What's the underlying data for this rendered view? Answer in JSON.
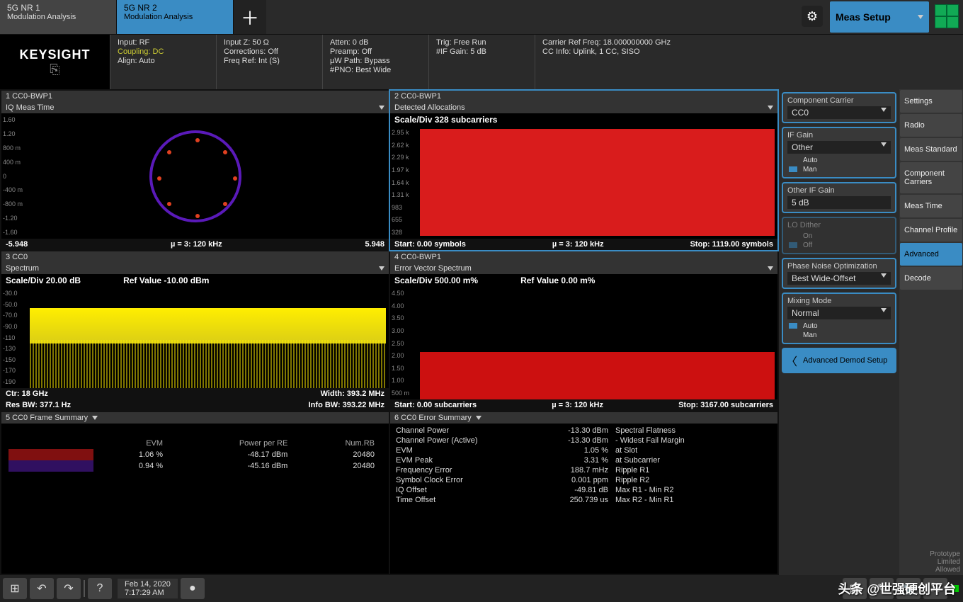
{
  "tabs": [
    {
      "title": "5G NR 1",
      "sub": "Modulation Analysis"
    },
    {
      "title": "5G NR 2",
      "sub": "Modulation Analysis"
    }
  ],
  "logo": "KEYSIGHT",
  "info": {
    "c1": {
      "a": "Input: RF",
      "b": "Coupling: DC",
      "c": "Align: Auto"
    },
    "c2": {
      "a": "Input Z: 50 Ω",
      "b": "Corrections: Off",
      "c": "Freq Ref: Int (S)"
    },
    "c3": {
      "a": "Atten: 0 dB",
      "b": "Preamp: Off",
      "c": "µW Path: Bypass",
      "d": "#PNO: Best Wide"
    },
    "c4": {
      "a": "Trig: Free Run",
      "b": "#IF Gain: 5 dB"
    },
    "c5": {
      "a": "Carrier Ref Freq: 18.000000000 GHz",
      "b": "CC Info: Uplink, 1 CC, SISO"
    }
  },
  "panels": {
    "p1": {
      "hdr1": "1 CC0-BWP1",
      "hdr2": "IQ Meas Time",
      "yticks": [
        "1.60",
        "1.20",
        "800 m",
        "400 m",
        "0",
        "-400 m",
        "-800 m",
        "-1.20",
        "-1.60"
      ],
      "fL": "-5.948",
      "fC": "µ = 3: 120 kHz",
      "fR": "5.948"
    },
    "p2": {
      "hdr1": "2 CC0-BWP1",
      "hdr2": "Detected Allocations",
      "scale": "Scale/Div 328 subcarriers",
      "yticks": [
        "2.95 k",
        "2.62 k",
        "2.29 k",
        "1.97 k",
        "1.64 k",
        "1.31 k",
        "983",
        "655",
        "328"
      ],
      "fL": "Start: 0.00 symbols",
      "fC": "µ = 3: 120 kHz",
      "fR": "Stop: 1119.00 symbols"
    },
    "p3": {
      "hdr1": "3 CC0",
      "hdr2": "Spectrum",
      "scaleL": "Scale/Div 20.00 dB",
      "scaleR": "Ref Value -10.00 dBm",
      "yticks": [
        "-30.0",
        "-50.0",
        "-70.0",
        "-90.0",
        "-110",
        "-130",
        "-150",
        "-170",
        "-190"
      ],
      "fL": "Ctr: 18 GHz",
      "fR": "Width: 393.2 MHz",
      "f2L": "Res BW: 377.1 Hz",
      "f2R": "Info BW: 393.22 MHz"
    },
    "p4": {
      "hdr1": "4 CC0-BWP1",
      "hdr2": "Error Vector Spectrum",
      "scaleL": "Scale/Div 500.00 m%",
      "scaleR": "Ref Value 0.00 m%",
      "yticks": [
        "4.50",
        "4.00",
        "3.50",
        "3.00",
        "2.50",
        "2.00",
        "1.50",
        "1.00",
        "500 m"
      ],
      "fL": "Start: 0.00 subcarriers",
      "fC": "µ = 3: 120 kHz",
      "fR": "Stop: 3167.00 subcarriers"
    },
    "p5": {
      "hdr": "5 CC0 Frame Summary",
      "th": [
        "",
        "EVM",
        "Power per RE",
        "Num.RB"
      ],
      "rows": [
        [
          "",
          "1.06 %",
          "-48.17 dBm",
          "20480"
        ],
        [
          "",
          "0.94 %",
          "-45.16 dBm",
          "20480"
        ]
      ]
    },
    "p6": {
      "hdr": "6 CC0 Error Summary",
      "rows": [
        [
          "Channel Power",
          "-13.30 dBm",
          "Spectral Flatness"
        ],
        [
          "Channel Power (Active)",
          "-13.30 dBm",
          "- Widest Fail Margin"
        ],
        [
          "EVM",
          "1.05 %",
          "at Slot"
        ],
        [
          "EVM Peak",
          "3.31 %",
          "at Subcarrier"
        ],
        [
          "Frequency Error",
          "188.7 mHz",
          "Ripple R1"
        ],
        [
          "Symbol Clock Error",
          "0.001 ppm",
          "Ripple R2"
        ],
        [
          "IQ Offset",
          "-49.81 dB",
          "Max R1 - Min R2"
        ],
        [
          "Time Offset",
          "250.739 us",
          "Max R2 - Min R1"
        ]
      ]
    }
  },
  "side": {
    "meas_setup": "Meas Setup",
    "cc_label": "Component Carrier",
    "cc_val": "CC0",
    "if_label": "IF Gain",
    "if_val": "Other",
    "auto": "Auto",
    "man": "Man",
    "oif_label": "Other IF Gain",
    "oif_val": "5 dB",
    "lod_label": "LO Dither",
    "on": "On",
    "off": "Off",
    "pno_label": "Phase Noise Optimization",
    "pno_val": "Best Wide-Offset",
    "mix_label": "Mixing Mode",
    "mix_val": "Normal",
    "adv": "Advanced Demod Setup",
    "btns": [
      "Settings",
      "Radio",
      "Meas Standard",
      "Component Carriers",
      "Meas Time",
      "Channel Profile",
      "Advanced",
      "Decode"
    ],
    "proto": [
      "Prototype",
      "Limited",
      "Allowed"
    ]
  },
  "bottom": {
    "date": "Feb 14, 2020",
    "time": "7:17:29 AM"
  },
  "credit": "头条 @世强硬创平台"
}
